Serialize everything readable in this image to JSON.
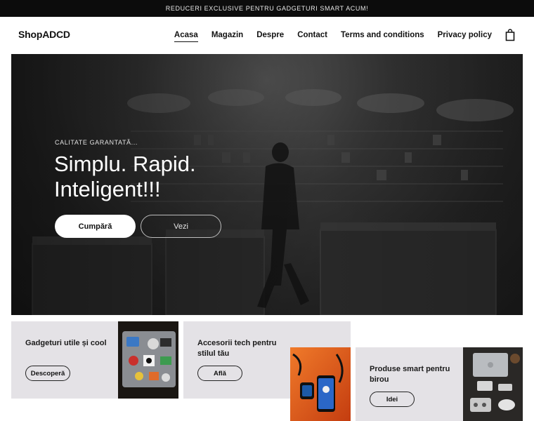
{
  "announcement": "REDUCERI EXCLUSIVE PENTRU GADGETURI SMART ACUM!",
  "header": {
    "logo": "ShopADCD",
    "nav": [
      {
        "label": "Acasa",
        "active": true
      },
      {
        "label": "Magazin",
        "active": false
      },
      {
        "label": "Despre",
        "active": false
      },
      {
        "label": "Contact",
        "active": false
      },
      {
        "label": "Terms and conditions",
        "active": false
      },
      {
        "label": "Privacy policy",
        "active": false
      }
    ],
    "cart_icon": "shopping-bag-icon"
  },
  "hero": {
    "eyebrow": "CALITATE GARANTATĂ...",
    "headline_line1": "Simplu. Rapid.",
    "headline_line2": "Inteligent!!!",
    "primary_button": "Cumpără",
    "secondary_button": "Vezi"
  },
  "cards": [
    {
      "title": "Gadgeturi utile și cool",
      "button": "Descoperă"
    },
    {
      "title": "Accesorii tech pentru stilul tău",
      "button": "Află"
    },
    {
      "title": "Produse smart pentru birou",
      "button": "Idei"
    }
  ]
}
